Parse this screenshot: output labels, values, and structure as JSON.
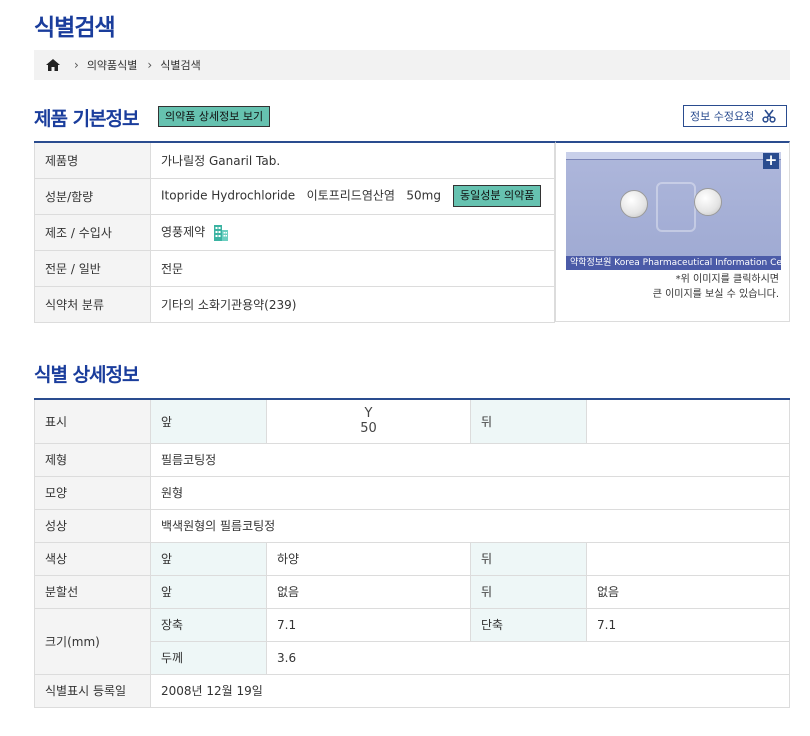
{
  "page_title": "식별검색",
  "breadcrumb": {
    "items": [
      "의약품식별",
      "식별검색"
    ]
  },
  "basic": {
    "title": "제품 기본정보",
    "detail_button": "의약품 상세정보 보기",
    "edit_button": "정보 수정요청",
    "rows": {
      "name_label": "제품명",
      "name_value": "가나릴정 Ganaril Tab.",
      "ingredient_label": "성분/함량",
      "ingredient_value": "Itopride Hydrochloride   이토프리드염산염   50mg",
      "same_ingredient_button": "동일성분 의약품",
      "maker_label": "제조 / 수입사",
      "maker_value": "영풍제약",
      "type_label": "전문 / 일반",
      "type_value": "전문",
      "class_label": "식약처 분류",
      "class_value": "기타의 소화기관용약(239)"
    },
    "image": {
      "zoom_label": "+",
      "footer_text": "약학정보원  Korea Pharmaceutical Information Center",
      "note_line1": "*위 이미지를 클릭하시면",
      "note_line2": "큰 이미지를 보실 수 있습니다."
    }
  },
  "detail": {
    "title": "식별 상세정보",
    "mark_label": "표시",
    "front": "앞",
    "back": "뒤",
    "mark_front_line1": "Y",
    "mark_front_line2": "50",
    "form_label": "제형",
    "form_value": "필름코팅정",
    "shape_label": "모양",
    "shape_value": "원형",
    "appearance_label": "성상",
    "appearance_value": "백색원형의 필름코팅정",
    "color_label": "색상",
    "color_front": "하양",
    "split_label": "분할선",
    "split_front": "없음",
    "split_back": "없음",
    "size_label": "크기(mm)",
    "long_axis_label": "장축",
    "long_axis_value": "7.1",
    "short_axis_label": "단축",
    "short_axis_value": "7.1",
    "thickness_label": "두께",
    "thickness_value": "3.6",
    "reg_date_label": "식별표시 등록일",
    "reg_date_value": "2008년 12월 19일"
  },
  "colors": {
    "title": "#1a3d9c",
    "accent_button": "#66c2b0",
    "table_top_border": "#2a4c8f"
  },
  "icons": [
    "home-icon",
    "chevron-right-icon",
    "scissors-icon",
    "building-icon",
    "plus-icon"
  ]
}
